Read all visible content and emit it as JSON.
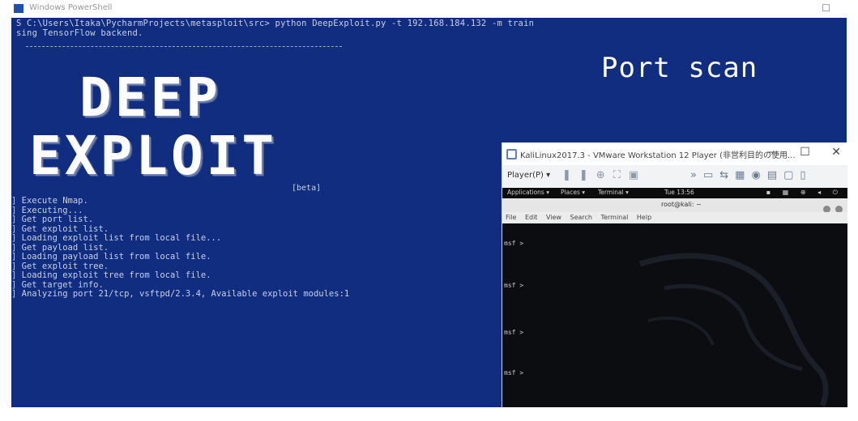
{
  "powershell": {
    "title": "Windows PowerShell",
    "command_line": "S C:\\Users\\Itaka\\PycharmProjects\\metasploit\\src> python DeepExploit.py -t 192.168.184.132 -m train",
    "backend_line": "sing TensorFlow backend.",
    "logo_line1": "DEEP",
    "logo_line2": "EXPLOIT",
    "beta": "[beta]",
    "log": [
      "] Execute Nmap.",
      "] Executing...",
      "] Get port list.",
      "] Get exploit list.",
      "] Loading exploit list from local file...",
      "] Get payload list.",
      "] Loading payload list from local file.",
      "] Get exploit tree.",
      "] Loading exploit tree from local file.",
      "] Get target info.",
      "] Analyzing port 21/tcp, vsftpd/2.3.4, Available exploit modules:1"
    ]
  },
  "overlay": {
    "caption": "Port scan"
  },
  "vmware": {
    "title": "KaliLinux2017.3 - VMware Workstation 12 Player (非営利目的の使用...",
    "player_menu": "Player(P) ▾",
    "kali_bar": {
      "applications": "Applications ▾",
      "places": "Places ▾",
      "terminal": "Terminal ▾",
      "clock": "Tue 13:56"
    },
    "terminal": {
      "title": "root@kali: ~",
      "menu": [
        "File",
        "Edit",
        "View",
        "Search",
        "Terminal",
        "Help"
      ],
      "prompts": [
        "msf >",
        "msf >",
        "msf >",
        "msf >"
      ]
    }
  }
}
